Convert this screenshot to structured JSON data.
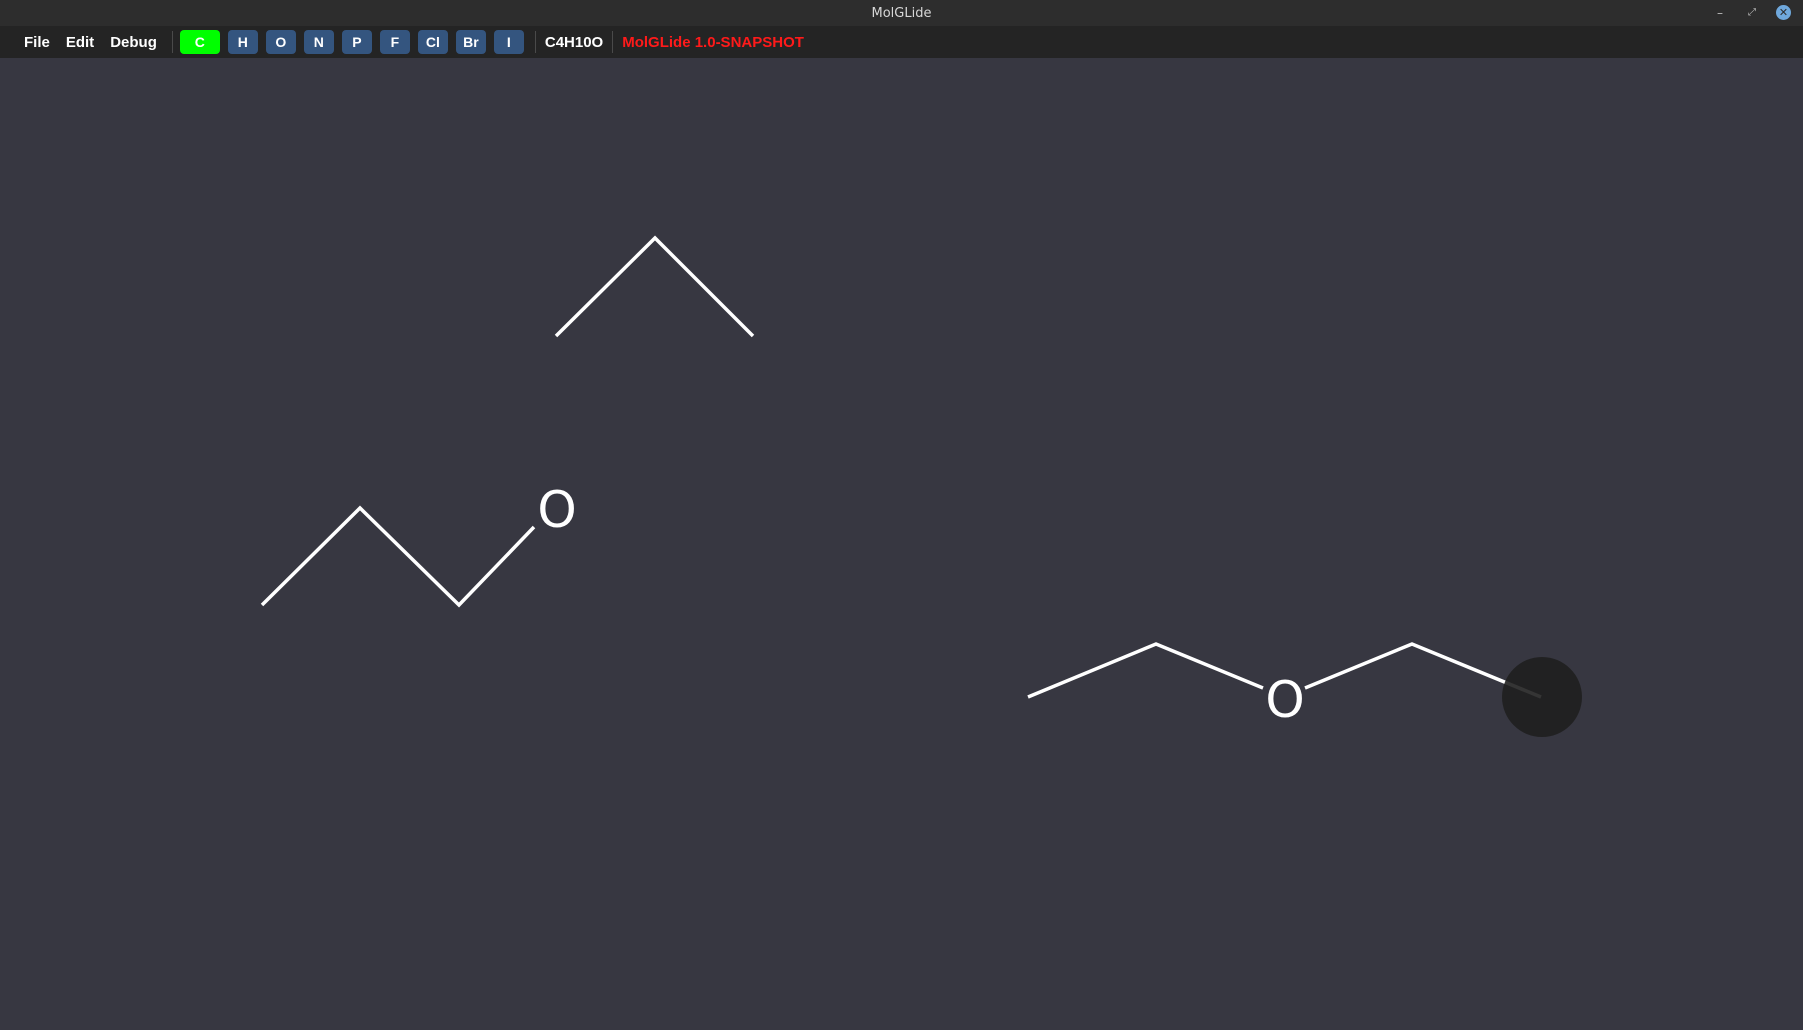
{
  "window": {
    "title": "MolGLide",
    "controls": {
      "minimize": "–",
      "maximize": "⤢",
      "close": "✕"
    }
  },
  "menubar": {
    "menus": [
      "File",
      "Edit",
      "Debug"
    ],
    "elements": [
      "C",
      "H",
      "O",
      "N",
      "P",
      "F",
      "Cl",
      "Br",
      "I"
    ],
    "selected_element": "C",
    "formula": "C4H10O",
    "version": "MolGLide 1.0-SNAPSHOT"
  },
  "canvas": {
    "atom_labels": [
      "O",
      "O"
    ]
  },
  "colors": {
    "background": "#373741",
    "bond": "#ffffff",
    "selected_button": "#00ff00",
    "element_button": "#34557f",
    "version_text": "#ff1a1a",
    "cursor_circle": "#1f1f1f"
  }
}
